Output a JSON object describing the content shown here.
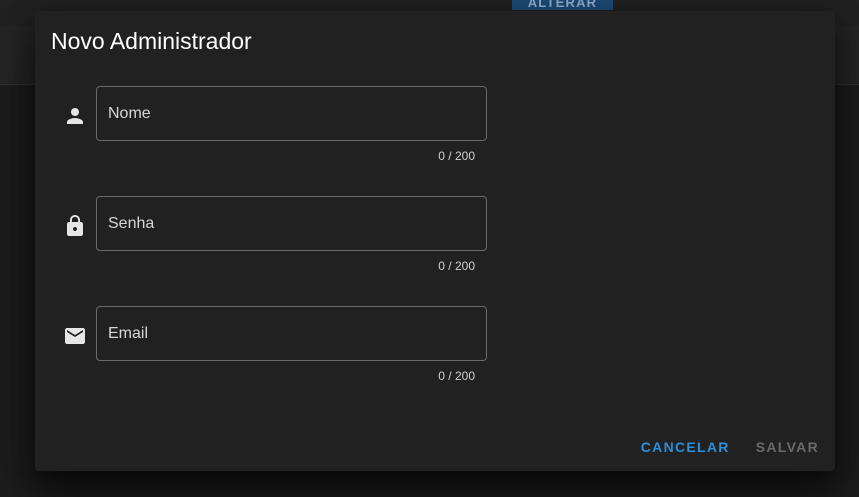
{
  "background": {
    "alter_button_label": "ALTERAR"
  },
  "dialog": {
    "title": "Novo Administrador",
    "fields": [
      {
        "icon": "person-icon",
        "placeholder": "Nome",
        "value": "",
        "counter": "0 / 200"
      },
      {
        "icon": "lock-icon",
        "placeholder": "Senha",
        "value": "",
        "counter": "0 / 200"
      },
      {
        "icon": "email-icon",
        "placeholder": "Email",
        "value": "",
        "counter": "0 / 200"
      }
    ],
    "actions": {
      "cancel_label": "CANCELAR",
      "save_label": "SALVAR"
    }
  },
  "colors": {
    "accent": "#2b8fdc",
    "disabled": "#6a6a6a",
    "surface": "#212121"
  }
}
